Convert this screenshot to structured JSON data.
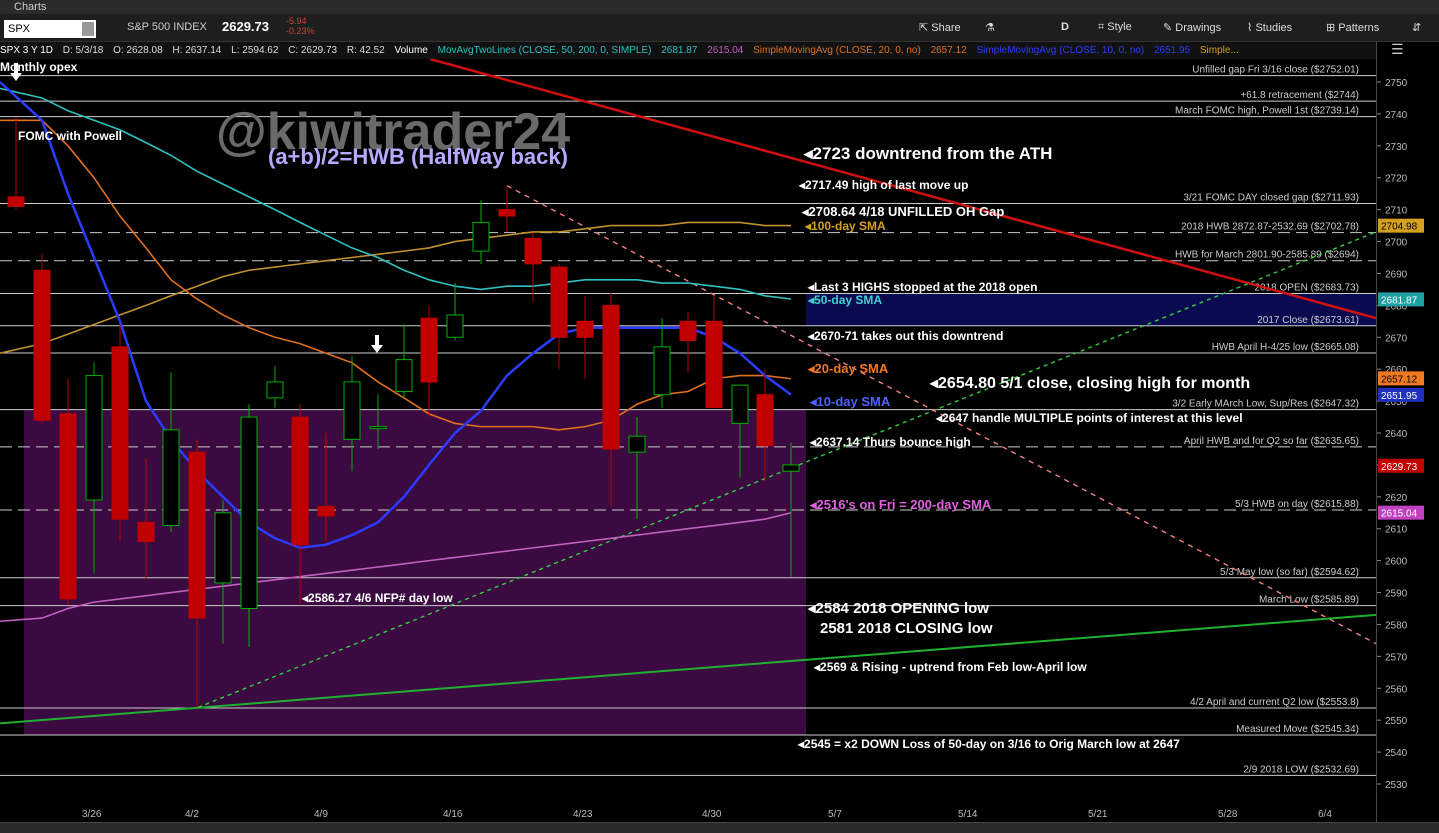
{
  "window": {
    "title": "Charts"
  },
  "toolbar": {
    "symbol": "SPX",
    "name": "S&P 500 INDEX",
    "last": "2629.73",
    "chg": "-5.94",
    "chg_pct": "-0.23%",
    "share": "Share",
    "period": "D",
    "style": "Style",
    "drawings": "Drawings",
    "studies": "Studies",
    "patterns": "Patterns"
  },
  "infobar": {
    "sym": "SPX 3 Y 1D",
    "d": "D: 5/3/18",
    "o": "O: 2628.08",
    "h": "H: 2637.14",
    "l": "L: 2594.62",
    "c": "C: 2629.73",
    "r": "R: 42.52",
    "vol": "Volume",
    "s1": "MovAvgTwoLines (CLOSE, 50, 200, 0, SIMPLE)",
    "s1a": "2681.87",
    "s1b": "2615.04",
    "s2": "SimpleMovingAvg (CLOSE, 20, 0, no)",
    "s2a": "2657.12",
    "s3": "SimpleMovingAvg (CLOSE, 10, 0, no)",
    "s3a": "2651.95",
    "s4": "Simple..."
  },
  "watermark": {
    "handle": "@kiwitrader24",
    "formula": "(a+b)/2=HWB (HalfWay back)"
  },
  "chart_data": {
    "type": "candlestick",
    "ylim": [
      2523,
      2758
    ],
    "yticks": [
      2530,
      2540,
      2550,
      2560,
      2570,
      2580,
      2590,
      2600,
      2610,
      2620,
      2630,
      2640,
      2650,
      2660,
      2670,
      2680,
      2690,
      2700,
      2710,
      2720,
      2730,
      2740,
      2750
    ],
    "xticks": [
      "3/26",
      "4/2",
      "4/9",
      "4/16",
      "4/23",
      "4/30",
      "5/7",
      "5/14",
      "5/21",
      "5/28",
      "6/4"
    ],
    "candles": [
      {
        "date": "3/21",
        "o": 2714,
        "h": 2739,
        "l": 2710,
        "c": 2711
      },
      {
        "date": "3/22",
        "o": 2691,
        "h": 2696,
        "l": 2643,
        "c": 2644
      },
      {
        "date": "3/23",
        "o": 2646,
        "h": 2657,
        "l": 2586,
        "c": 2588
      },
      {
        "date": "3/26",
        "o": 2619,
        "h": 2662,
        "l": 2596,
        "c": 2658
      },
      {
        "date": "3/27",
        "o": 2667,
        "h": 2674,
        "l": 2606,
        "c": 2613
      },
      {
        "date": "3/28",
        "o": 2612,
        "h": 2632,
        "l": 2594,
        "c": 2606
      },
      {
        "date": "3/29",
        "o": 2611,
        "h": 2659,
        "l": 2609,
        "c": 2641
      },
      {
        "date": "4/2",
        "o": 2634,
        "h": 2638,
        "l": 2554,
        "c": 2582
      },
      {
        "date": "4/3",
        "o": 2593,
        "h": 2619,
        "l": 2574,
        "c": 2615
      },
      {
        "date": "4/4",
        "o": 2585,
        "h": 2649,
        "l": 2573,
        "c": 2645
      },
      {
        "date": "4/5",
        "o": 2651,
        "h": 2661,
        "l": 2648,
        "c": 2656
      },
      {
        "date": "4/6",
        "o": 2645,
        "h": 2649,
        "l": 2586,
        "c": 2605
      },
      {
        "date": "4/9",
        "o": 2617,
        "h": 2640,
        "l": 2606,
        "c": 2614
      },
      {
        "date": "4/10",
        "o": 2638,
        "h": 2664,
        "l": 2628,
        "c": 2656
      },
      {
        "date": "4/11",
        "o": 2642,
        "h": 2652,
        "l": 2635,
        "c": 2642
      },
      {
        "date": "4/12",
        "o": 2653,
        "h": 2674,
        "l": 2651,
        "c": 2663
      },
      {
        "date": "4/13",
        "o": 2676,
        "h": 2680,
        "l": 2645,
        "c": 2656
      },
      {
        "date": "4/16",
        "o": 2670,
        "h": 2687,
        "l": 2669,
        "c": 2677
      },
      {
        "date": "4/17",
        "o": 2697,
        "h": 2713,
        "l": 2693,
        "c": 2706
      },
      {
        "date": "4/18",
        "o": 2710,
        "h": 2717,
        "l": 2703,
        "c": 2708
      },
      {
        "date": "4/19",
        "o": 2701,
        "h": 2703,
        "l": 2681,
        "c": 2693
      },
      {
        "date": "4/20",
        "o": 2692,
        "h": 2693,
        "l": 2660,
        "c": 2670
      },
      {
        "date": "4/23",
        "o": 2675,
        "h": 2683,
        "l": 2657,
        "c": 2670
      },
      {
        "date": "4/24",
        "o": 2680,
        "h": 2684,
        "l": 2617,
        "c": 2635
      },
      {
        "date": "4/25",
        "o": 2634,
        "h": 2645,
        "l": 2613,
        "c": 2639
      },
      {
        "date": "4/26",
        "o": 2652,
        "h": 2676,
        "l": 2648,
        "c": 2667
      },
      {
        "date": "4/27",
        "o": 2675,
        "h": 2678,
        "l": 2659,
        "c": 2669
      },
      {
        "date": "4/30",
        "o": 2675,
        "h": 2683,
        "l": 2648,
        "c": 2648
      },
      {
        "date": "5/1",
        "o": 2643,
        "h": 2655,
        "l": 2626,
        "c": 2655
      },
      {
        "date": "5/2",
        "o": 2652,
        "h": 2660,
        "l": 2625,
        "c": 2636
      },
      {
        "date": "5/3",
        "o": 2628,
        "h": 2637,
        "l": 2595,
        "c": 2630
      }
    ]
  },
  "hlines": [
    {
      "label": "Unfilled gap Fri 3/16 close ($2752.01)",
      "value": 2752.01
    },
    {
      "label": "+61.8 retracement ($2744)",
      "value": 2744
    },
    {
      "label": "March FOMC high, Powell 1st ($2739.14)",
      "value": 2739.14
    },
    {
      "label": "3/21 FOMC DAY closed gap ($2711.93)",
      "value": 2711.93
    },
    {
      "label": "2018 HWB 2872.87-2532.69 ($2702.78)",
      "value": 2702.78
    },
    {
      "label": "HWB for March 2801.90-2585.89 ($2694)",
      "value": 2694
    },
    {
      "label": "2018 OPEN ($2683.73)",
      "value": 2683.73
    },
    {
      "label": "2017 Close ($2673.61)",
      "value": 2673.61
    },
    {
      "label": "HWB April H-4/25 low ($2665.08)",
      "value": 2665.08
    },
    {
      "label": "3/2 Early MArch Low, Sup/Res ($2647.32)",
      "value": 2647.32
    },
    {
      "label": "April HWB and for Q2 so far ($2635.65)",
      "value": 2635.65
    },
    {
      "label": "5/3 HWB on day ($2615.88)",
      "value": 2615.88
    },
    {
      "label": "5/3 May low (so far) ($2594.62)",
      "value": 2594.62
    },
    {
      "label": "March Low ($2585.89)",
      "value": 2585.89
    },
    {
      "label": "4/2 April and current Q2 low ($2553.8)",
      "value": 2553.8
    },
    {
      "label": "Measured Move ($2545.34)",
      "value": 2545.34
    },
    {
      "label": "2/9 2018 LOW ($2532.69)",
      "value": 2532.69
    }
  ],
  "annotations": [
    {
      "text": "Monthly opex",
      "color": "#ffffff"
    },
    {
      "text": "FOMC with Powell",
      "color": "#ffffff"
    },
    {
      "text": "2723 downtrend from the ATH",
      "color": "#ffffff"
    },
    {
      "text": "2717.49 high of last move up",
      "color": "#ffffff"
    },
    {
      "text": "2708.64 4/18 UNFILLED OH Gap",
      "color": "#ffffff"
    },
    {
      "text": "100-day SMA",
      "color": "#d4a020"
    },
    {
      "text": "Last 3 HIGHS  stopped at the 2018 open",
      "color": "#ffffff"
    },
    {
      "text": "50-day SMA",
      "color": "#40d0d0"
    },
    {
      "text": "2670-71 takes out this downtrend",
      "color": "#ffffff"
    },
    {
      "text": "20-day SMA",
      "color": "#f07820"
    },
    {
      "text": "2654.80 5/1 close,  closing high for month",
      "color": "#ffffff"
    },
    {
      "text": "10-day SMA",
      "color": "#5060ff"
    },
    {
      "text": "2647 handle MULTIPLE points of interest at this level",
      "color": "#ffffff"
    },
    {
      "text": "2637.14 Thurs bounce high",
      "color": "#ffffff"
    },
    {
      "text": "2516's  on Fri = 200-day SMA",
      "color": "#e060e0"
    },
    {
      "text": "2586.27 4/6 NFP# day low",
      "color": "#ffffff"
    },
    {
      "text": "2584 2018 OPENING low",
      "color": "#ffffff"
    },
    {
      "text": "2581 2018 CLOSING low",
      "color": "#ffffff"
    },
    {
      "text": "2569 & Rising - uptrend from Feb low-April low",
      "color": "#ffffff"
    },
    {
      "text": "2545 = x2 DOWN Loss of 50-day on 3/16 to Orig March low at 2647",
      "color": "#ffffff"
    }
  ],
  "axis_tags": [
    {
      "text": "2704.98",
      "value": 2704.98,
      "bg": "#d4a020",
      "fg": "#000"
    },
    {
      "text": "2681.87",
      "value": 2681.87,
      "bg": "#20a0a0",
      "fg": "#fff"
    },
    {
      "text": "2657.12",
      "value": 2657.12,
      "bg": "#f07820",
      "fg": "#000"
    },
    {
      "text": "2651.95",
      "value": 2651.95,
      "bg": "#2030c0",
      "fg": "#fff"
    },
    {
      "text": "2629.73",
      "value": 2629.73,
      "bg": "#c00000",
      "fg": "#fff"
    },
    {
      "text": "2615.04",
      "value": 2615.04,
      "bg": "#c040c0",
      "fg": "#fff"
    }
  ],
  "colors": {
    "up": "#00b000",
    "down": "#c00000",
    "sma10": "#2a3cff",
    "sma20": "#e07020",
    "sma50": "#30c0c0",
    "sma100": "#c09030",
    "sma200": "#c060c0",
    "downtrend": "#d01010",
    "uptrend": "#20b030",
    "zone_purple": "#3a0a40",
    "zone_blue": "#0a0a50"
  }
}
